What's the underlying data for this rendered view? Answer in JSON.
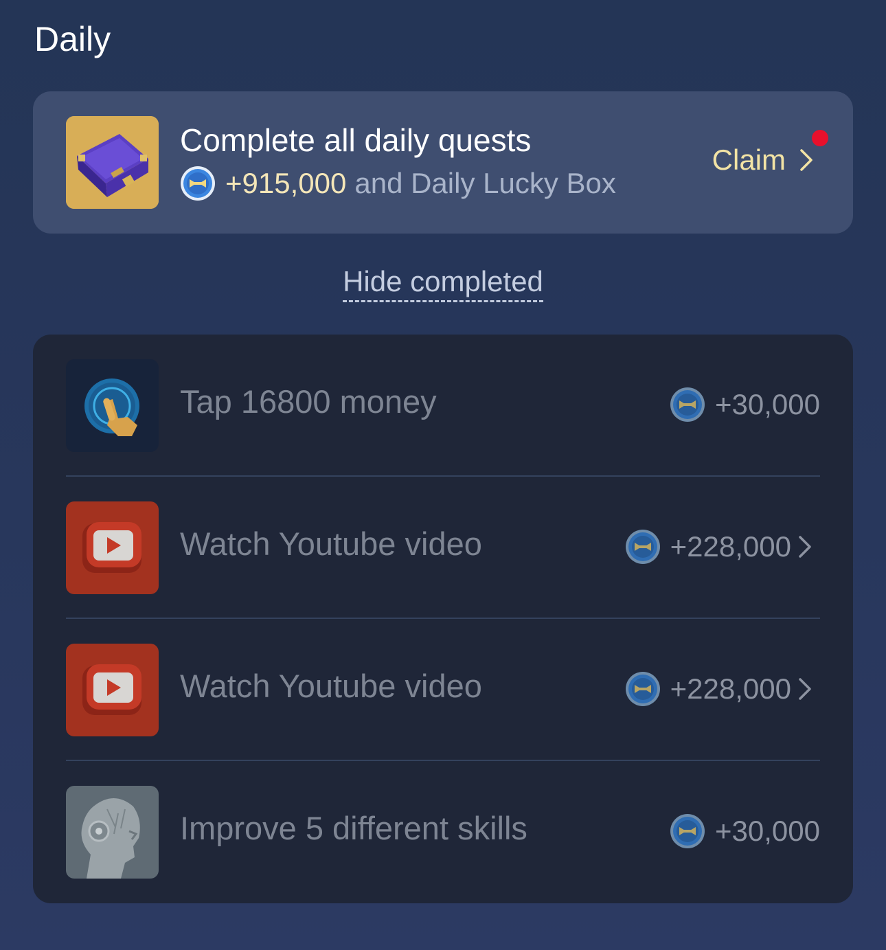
{
  "section": {
    "title": "Daily"
  },
  "bonus": {
    "title": "Complete all daily quests",
    "amount": "+915,000",
    "rest": "and Daily Lucky Box",
    "claim_label": "Claim",
    "thumb_icon": "purple-briefcase-icon",
    "has_notification": true
  },
  "toggle": {
    "label": "Hide completed"
  },
  "quests": [
    {
      "label": "Tap 16800 money",
      "reward": "+30,000",
      "icon": "tap-hand-icon"
    },
    {
      "label": "Watch Youtube video",
      "reward": "+228,000",
      "icon": "youtube-icon"
    },
    {
      "label": "Watch Youtube video",
      "reward": "+228,000",
      "icon": "youtube-icon"
    },
    {
      "label": "Improve 5 different skills",
      "reward": "+30,000",
      "icon": "robot-head-icon"
    }
  ],
  "colors": {
    "background": "#243556",
    "card": "#3f4e70",
    "list": "#1f2638",
    "claim": "#f2e3a5",
    "notification_dot": "#e8102c",
    "coin": "#2f7fd6"
  }
}
